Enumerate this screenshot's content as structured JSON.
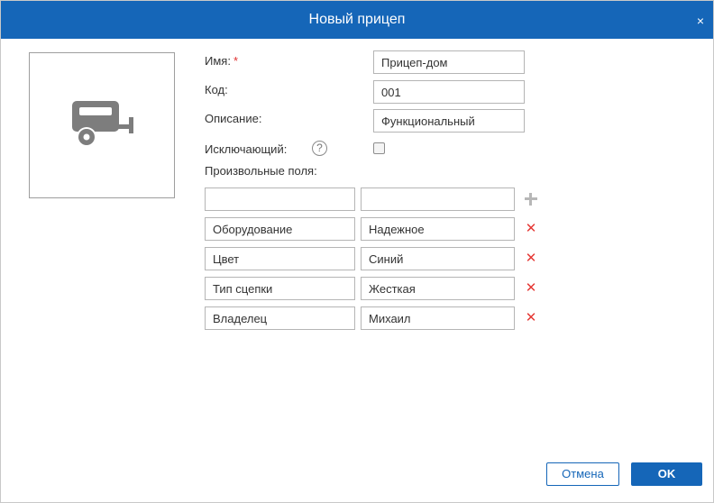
{
  "dialog": {
    "title": "Новый прицеп",
    "close_symbol": "×"
  },
  "image": {
    "icon": "trailer-icon",
    "icon_color": "#7d7d7d"
  },
  "form": {
    "name_label": "Имя:",
    "name_required_mark": "*",
    "name_value": "Прицеп-дом",
    "code_label": "Код:",
    "code_value": "001",
    "description_label": "Описание:",
    "description_value": "Функциональный",
    "exclusive_label": "Исключающий:",
    "exclusive_help_symbol": "?",
    "exclusive_checked": false,
    "custom_fields_label": "Произвольные поля:",
    "new_field": {
      "name": "",
      "value": ""
    },
    "custom_fields": [
      {
        "name": "Оборудование",
        "value": "Надежное"
      },
      {
        "name": "Цвет",
        "value": "Синий"
      },
      {
        "name": "Тип сцепки",
        "value": "Жесткая"
      },
      {
        "name": "Владелец",
        "value": "Михаил"
      }
    ],
    "remove_symbol": "✕"
  },
  "buttons": {
    "cancel": "Отмена",
    "ok": "OK"
  },
  "colors": {
    "accent": "#1566b8",
    "remove": "#e53935",
    "required": "#e03030"
  }
}
